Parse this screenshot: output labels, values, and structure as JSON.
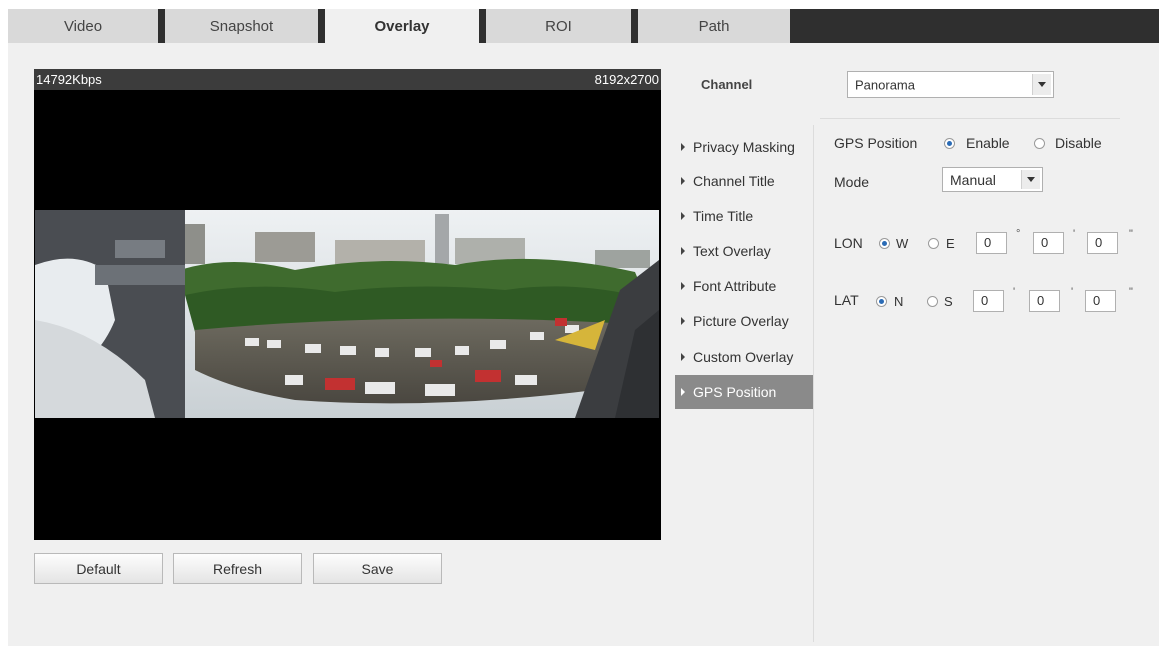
{
  "tabs": [
    {
      "label": "Video"
    },
    {
      "label": "Snapshot"
    },
    {
      "label": "Overlay",
      "active": true
    },
    {
      "label": "ROI"
    },
    {
      "label": "Path"
    }
  ],
  "video": {
    "bitrate": "14792Kbps",
    "resolution": "8192x2700"
  },
  "buttons": {
    "default": "Default",
    "refresh": "Refresh",
    "save": "Save"
  },
  "channel": {
    "label": "Channel",
    "value": "Panorama"
  },
  "menu": [
    {
      "label": "Privacy Masking"
    },
    {
      "label": "Channel Title"
    },
    {
      "label": "Time Title"
    },
    {
      "label": "Text Overlay"
    },
    {
      "label": "Font Attribute"
    },
    {
      "label": "Picture Overlay"
    },
    {
      "label": "Custom Overlay"
    },
    {
      "label": "GPS Position",
      "active": true
    }
  ],
  "gps": {
    "label": "GPS Position",
    "enable": "Enable",
    "disable": "Disable",
    "enabled": true,
    "mode_label": "Mode",
    "mode_value": "Manual",
    "lon": {
      "label": "LON",
      "opt1": "W",
      "opt2": "E",
      "selected": "W",
      "deg": "0",
      "min": "0",
      "sec": "0"
    },
    "lat": {
      "label": "LAT",
      "opt1": "N",
      "opt2": "S",
      "selected": "N",
      "deg": "0",
      "min": "0",
      "sec": "0"
    },
    "units": {
      "deg": "°",
      "min": "'",
      "sec": "\""
    }
  },
  "colors": {
    "tab_bar": "#2f2f2f",
    "active_menu": "#8a8a8a",
    "radio_dot": "#2a6bb5"
  }
}
